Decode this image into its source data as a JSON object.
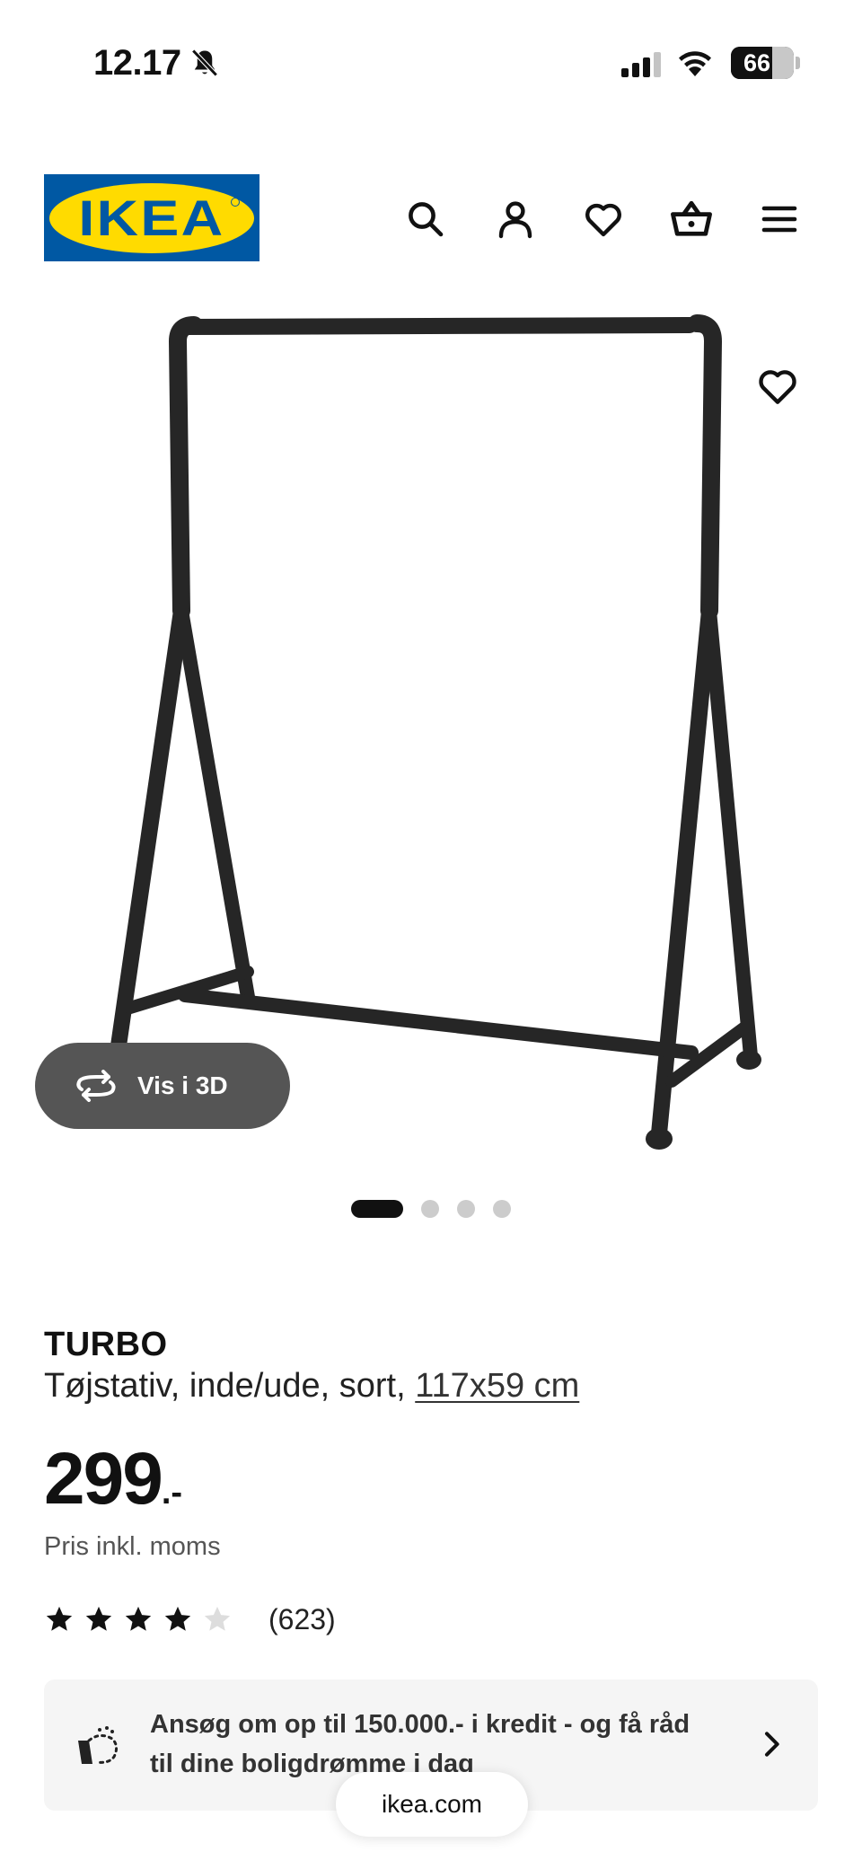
{
  "status_bar": {
    "time": "12.17",
    "battery_level": "66"
  },
  "header": {
    "logo_text": "IKEA",
    "icons": [
      "search-icon",
      "user-icon",
      "heart-icon",
      "basket-icon",
      "menu-icon"
    ]
  },
  "gallery": {
    "view_3d_label": "Vis i 3D",
    "total_images": 4,
    "active_index": 0
  },
  "product": {
    "name": "TURBO",
    "description": "Tøjstativ, inde/ude, sort, ",
    "size": "117x59 cm",
    "price_main": "299",
    "price_suffix": ".-",
    "price_note": "Pris inkl. moms",
    "rating_value": 4,
    "rating_max": 5,
    "rating_count": "(623)"
  },
  "credit_banner": {
    "text": "Ansøg om op til 150.000.- i kredit - og få råd til dine boligdrømme i dag"
  },
  "browser": {
    "url": "ikea.com"
  },
  "colors": {
    "ikea_blue": "#0058a3",
    "ikea_yellow": "#ffdb00",
    "pill_grey": "#555555"
  }
}
